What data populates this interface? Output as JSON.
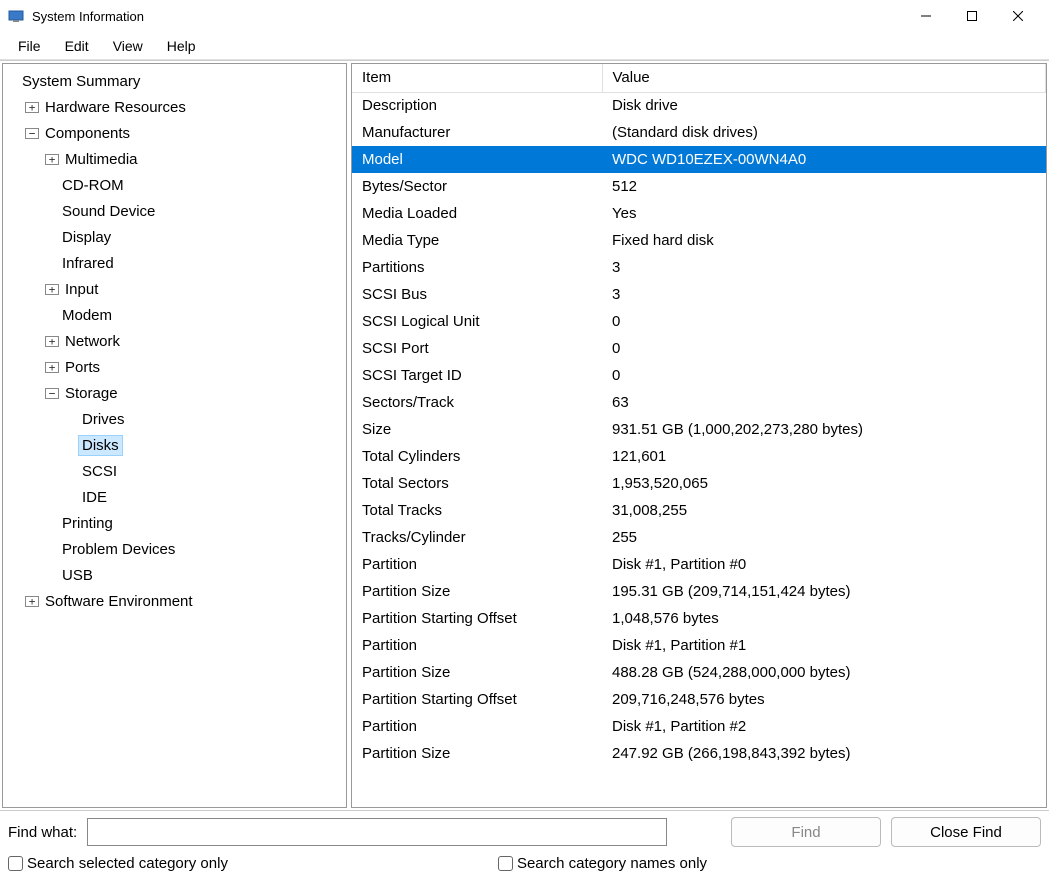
{
  "window_title": "System Information",
  "menu": [
    "File",
    "Edit",
    "View",
    "Help"
  ],
  "tree": [
    {
      "label": "System Summary",
      "depth": 0,
      "expander": null
    },
    {
      "label": "Hardware Resources",
      "depth": 1,
      "expander": "+"
    },
    {
      "label": "Components",
      "depth": 1,
      "expander": "-"
    },
    {
      "label": "Multimedia",
      "depth": 2,
      "expander": "+"
    },
    {
      "label": "CD-ROM",
      "depth": 2,
      "expander": null
    },
    {
      "label": "Sound Device",
      "depth": 2,
      "expander": null
    },
    {
      "label": "Display",
      "depth": 2,
      "expander": null
    },
    {
      "label": "Infrared",
      "depth": 2,
      "expander": null
    },
    {
      "label": "Input",
      "depth": 2,
      "expander": "+"
    },
    {
      "label": "Modem",
      "depth": 2,
      "expander": null
    },
    {
      "label": "Network",
      "depth": 2,
      "expander": "+"
    },
    {
      "label": "Ports",
      "depth": 2,
      "expander": "+"
    },
    {
      "label": "Storage",
      "depth": 2,
      "expander": "-"
    },
    {
      "label": "Drives",
      "depth": 3,
      "expander": null
    },
    {
      "label": "Disks",
      "depth": 3,
      "expander": null,
      "selected": true
    },
    {
      "label": "SCSI",
      "depth": 3,
      "expander": null
    },
    {
      "label": "IDE",
      "depth": 3,
      "expander": null
    },
    {
      "label": "Printing",
      "depth": 2,
      "expander": null
    },
    {
      "label": "Problem Devices",
      "depth": 2,
      "expander": null
    },
    {
      "label": "USB",
      "depth": 2,
      "expander": null
    },
    {
      "label": "Software Environment",
      "depth": 1,
      "expander": "+"
    }
  ],
  "columns": {
    "item": "Item",
    "value": "Value"
  },
  "details": [
    {
      "item": "Description",
      "value": "Disk drive"
    },
    {
      "item": "Manufacturer",
      "value": "(Standard disk drives)"
    },
    {
      "item": "Model",
      "value": "WDC WD10EZEX-00WN4A0",
      "selected": true
    },
    {
      "item": "Bytes/Sector",
      "value": "512"
    },
    {
      "item": "Media Loaded",
      "value": "Yes"
    },
    {
      "item": "Media Type",
      "value": "Fixed hard disk"
    },
    {
      "item": "Partitions",
      "value": "3"
    },
    {
      "item": "SCSI Bus",
      "value": "3"
    },
    {
      "item": "SCSI Logical Unit",
      "value": "0"
    },
    {
      "item": "SCSI Port",
      "value": "0"
    },
    {
      "item": "SCSI Target ID",
      "value": "0"
    },
    {
      "item": "Sectors/Track",
      "value": "63"
    },
    {
      "item": "Size",
      "value": "931.51 GB (1,000,202,273,280 bytes)"
    },
    {
      "item": "Total Cylinders",
      "value": "121,601"
    },
    {
      "item": "Total Sectors",
      "value": "1,953,520,065"
    },
    {
      "item": "Total Tracks",
      "value": "31,008,255"
    },
    {
      "item": "Tracks/Cylinder",
      "value": "255"
    },
    {
      "item": "Partition",
      "value": "Disk #1, Partition #0"
    },
    {
      "item": "Partition Size",
      "value": "195.31 GB (209,714,151,424 bytes)"
    },
    {
      "item": "Partition Starting Offset",
      "value": "1,048,576 bytes"
    },
    {
      "item": "Partition",
      "value": "Disk #1, Partition #1"
    },
    {
      "item": "Partition Size",
      "value": "488.28 GB (524,288,000,000 bytes)"
    },
    {
      "item": "Partition Starting Offset",
      "value": "209,716,248,576 bytes"
    },
    {
      "item": "Partition",
      "value": "Disk #1, Partition #2"
    },
    {
      "item": "Partition Size",
      "value": "247.92 GB (266,198,843,392 bytes)"
    }
  ],
  "find": {
    "label": "Find what:",
    "find_btn": "Find",
    "close_btn": "Close Find",
    "opt1": "Search selected category only",
    "opt2": "Search category names only"
  }
}
